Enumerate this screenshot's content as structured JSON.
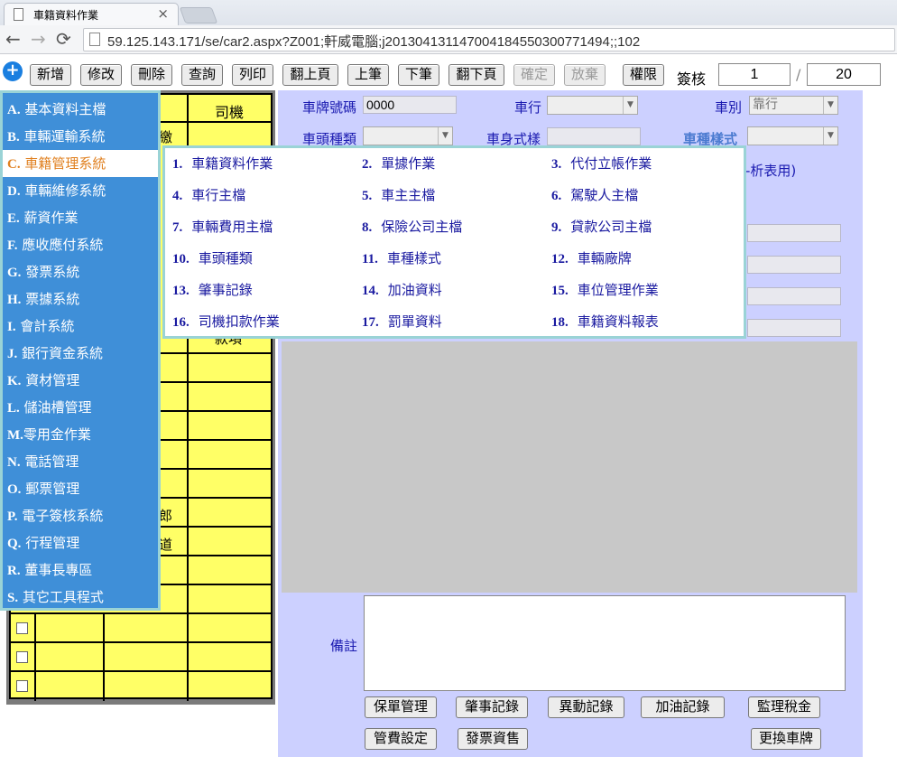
{
  "browser": {
    "tab_title": "車籍資料作業",
    "url": "59.125.143.171/se/car2.aspx?Z001;軒威電腦;j20130413114700418455030077149​4;;102"
  },
  "toolbar": {
    "buttons": [
      {
        "label": "新增",
        "enabled": true
      },
      {
        "label": "修改",
        "enabled": true
      },
      {
        "label": "刪除",
        "enabled": true
      },
      {
        "label": "查詢",
        "enabled": true
      },
      {
        "label": "列印",
        "enabled": true
      },
      {
        "label": "翻上頁",
        "enabled": true
      },
      {
        "label": "上筆",
        "enabled": true
      },
      {
        "label": "下筆",
        "enabled": true
      },
      {
        "label": "翻下頁",
        "enabled": true
      },
      {
        "label": "確定",
        "enabled": false
      },
      {
        "label": "放棄",
        "enabled": false
      },
      {
        "label": "權限",
        "enabled": true
      }
    ],
    "sign_label": "簽核",
    "current_record": "1",
    "total_records": "20"
  },
  "grid": {
    "header_driver": "司機",
    "partial_cells": [
      "繳",
      "款項",
      "郎",
      "道"
    ]
  },
  "form": {
    "plate_label": "車牌號碼",
    "plate_value": "0000",
    "company_label": "車行",
    "type_label": "車別",
    "type_value": "靠行",
    "head_type_label": "車頭種類",
    "body_style_label": "車身式樣",
    "car_style_label": "車種樣式",
    "analysis_note": "-析表用)",
    "remarks_label": "備註"
  },
  "bottom_buttons": [
    "保單管理",
    "肇事記錄",
    "異動記錄",
    "加油記錄",
    "監理稅金",
    "管費設定",
    "發票資售",
    "更換車牌"
  ],
  "menu": {
    "items": [
      {
        "key": "A.",
        "label": "基本資料主檔"
      },
      {
        "key": "B.",
        "label": "車輛運輸系統"
      },
      {
        "key": "C.",
        "label": "車籍管理系統",
        "active": true
      },
      {
        "key": "D.",
        "label": "車輛維修系統"
      },
      {
        "key": "E.",
        "label": "薪資作業"
      },
      {
        "key": "F.",
        "label": "應收應付系統"
      },
      {
        "key": "G.",
        "label": "發票系統"
      },
      {
        "key": "H.",
        "label": "票據系統"
      },
      {
        "key": "I.",
        "label": "會計系統"
      },
      {
        "key": "J.",
        "label": "銀行資金系統"
      },
      {
        "key": "K.",
        "label": "資材管理"
      },
      {
        "key": "L.",
        "label": "儲油槽管理"
      },
      {
        "key": "M.",
        "label": "零用金作業"
      },
      {
        "key": "N.",
        "label": "電話管理"
      },
      {
        "key": "O.",
        "label": "郵票管理"
      },
      {
        "key": "P.",
        "label": "電子簽核系統"
      },
      {
        "key": "Q.",
        "label": "行程管理"
      },
      {
        "key": "R.",
        "label": "董事長專區"
      },
      {
        "key": "S.",
        "label": "其它工具程式"
      }
    ]
  },
  "submenu": {
    "items": [
      {
        "num": "1.",
        "label": "車籍資料作業"
      },
      {
        "num": "2.",
        "label": "單據作業"
      },
      {
        "num": "3.",
        "label": "代付立帳作業"
      },
      {
        "num": "4.",
        "label": "車行主檔"
      },
      {
        "num": "5.",
        "label": "車主主檔"
      },
      {
        "num": "6.",
        "label": "駕駛人主檔"
      },
      {
        "num": "7.",
        "label": "車輛費用主檔"
      },
      {
        "num": "8.",
        "label": "保險公司主檔"
      },
      {
        "num": "9.",
        "label": "貸款公司主檔"
      },
      {
        "num": "10.",
        "label": "車頭種類"
      },
      {
        "num": "11.",
        "label": "車種樣式"
      },
      {
        "num": "12.",
        "label": "車輛廠牌"
      },
      {
        "num": "13.",
        "label": "肇事記錄"
      },
      {
        "num": "14.",
        "label": "加油資料"
      },
      {
        "num": "15.",
        "label": "車位管理作業"
      },
      {
        "num": "16.",
        "label": "司機扣款作業"
      },
      {
        "num": "17.",
        "label": "罰單資料"
      },
      {
        "num": "18.",
        "label": "車籍資料報表"
      }
    ]
  }
}
